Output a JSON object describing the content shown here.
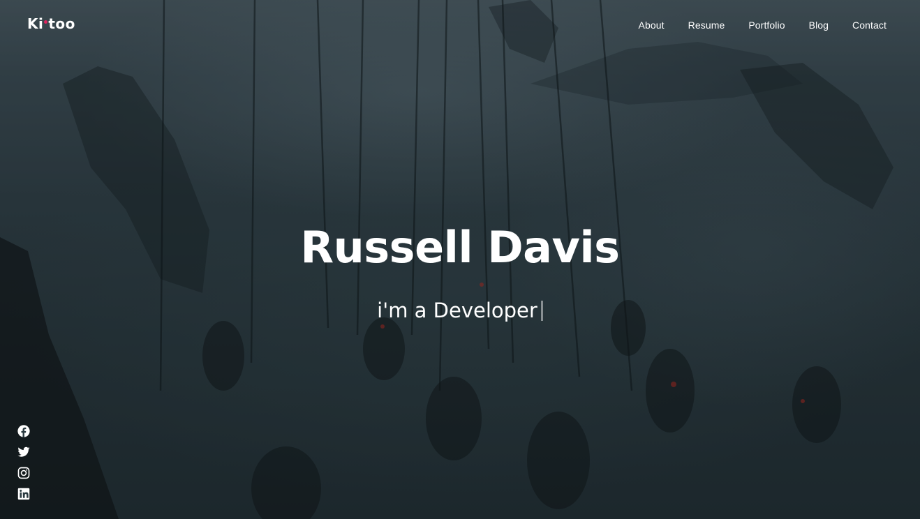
{
  "header": {
    "logo_pre": "Ki",
    "logo_post": "too",
    "nav": [
      {
        "label": "About"
      },
      {
        "label": "Resume"
      },
      {
        "label": "Portfolio"
      },
      {
        "label": "Blog"
      },
      {
        "label": "Contact"
      }
    ]
  },
  "hero": {
    "name": "Russell Davis",
    "tagline": "i'm a Developer"
  },
  "social": [
    {
      "icon": "facebook-icon"
    },
    {
      "icon": "twitter-icon"
    },
    {
      "icon": "instagram-icon"
    },
    {
      "icon": "linkedin-icon"
    }
  ],
  "colors": {
    "accent": "#e0245e",
    "text": "#ffffff"
  }
}
